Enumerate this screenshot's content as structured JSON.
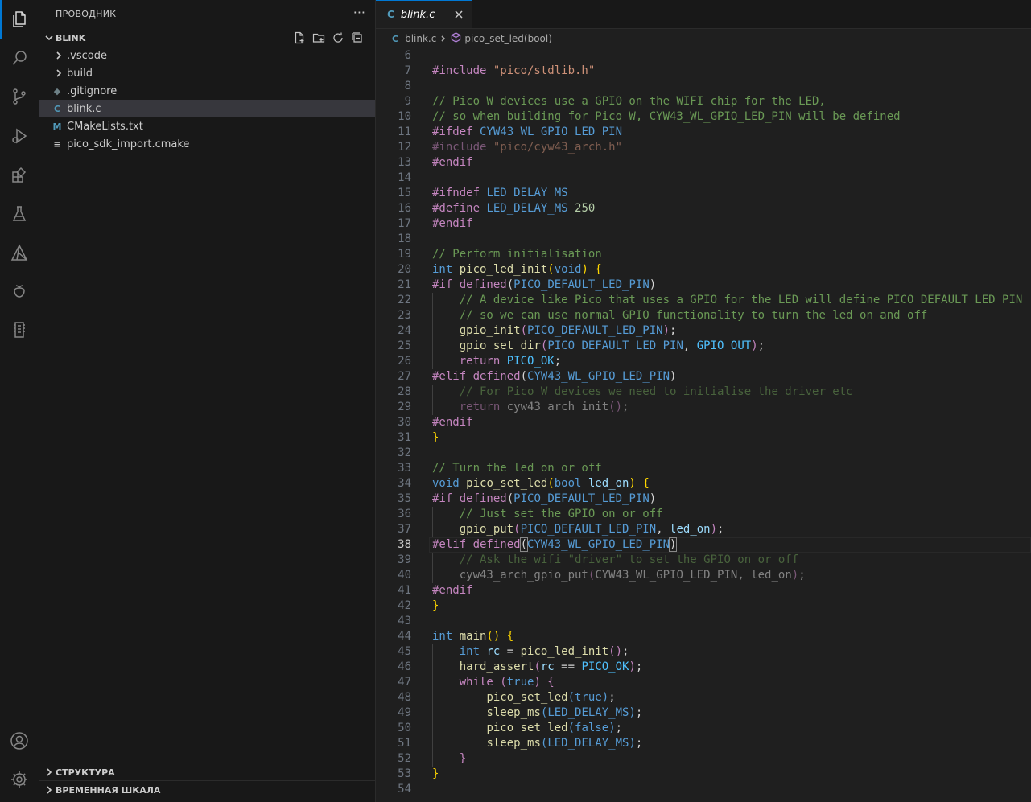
{
  "activity_bar": {
    "items": [
      "explorer-icon",
      "search-icon",
      "source-control-icon",
      "run-debug-icon",
      "extensions-icon",
      "testing-icon",
      "cmake-icon",
      "raspberry-pi-icon",
      "serial-monitor-icon"
    ],
    "bottom": [
      "accounts-icon",
      "settings-gear-icon"
    ]
  },
  "sidebar": {
    "title": "ПРОВОДНИК",
    "folder": "BLINK",
    "items": [
      {
        "label": ".vscode",
        "type": "folder"
      },
      {
        "label": "build",
        "type": "folder"
      },
      {
        "label": ".gitignore",
        "type": "file",
        "icon": "◆",
        "color": "#6d8086"
      },
      {
        "label": "blink.c",
        "type": "file",
        "icon": "C",
        "color": "#519aba",
        "selected": true
      },
      {
        "label": "CMakeLists.txt",
        "type": "file",
        "icon": "M",
        "color": "#519aba"
      },
      {
        "label": "pico_sdk_import.cmake",
        "type": "file",
        "icon": "≡",
        "color": "#cccccc"
      }
    ],
    "bottom_sections": [
      "СТРУКТУРА",
      "ВРЕМЕННАЯ ШКАЛА"
    ]
  },
  "editor": {
    "tab": {
      "icon": "C",
      "label": "blink.c"
    },
    "breadcrumb": {
      "file_icon": "C",
      "file": "blink.c",
      "symbol": "pico_set_led(bool)"
    },
    "current_line": 38,
    "lines": [
      {
        "n": 6,
        "indent": 0,
        "tokens": []
      },
      {
        "n": 7,
        "indent": 0,
        "tokens": [
          [
            "p",
            "#include "
          ],
          [
            "s",
            "\"pico/stdlib.h\""
          ]
        ]
      },
      {
        "n": 8,
        "indent": 0,
        "tokens": []
      },
      {
        "n": 9,
        "indent": 0,
        "tokens": [
          [
            "c",
            "// Pico W devices use a GPIO on the WIFI chip for the LED,"
          ]
        ]
      },
      {
        "n": 10,
        "indent": 0,
        "tokens": [
          [
            "c",
            "// so when building for Pico W, CYW43_WL_GPIO_LED_PIN will be defined"
          ]
        ]
      },
      {
        "n": 11,
        "indent": 0,
        "tokens": [
          [
            "p",
            "#ifdef "
          ],
          [
            "m",
            "CYW43_WL_GPIO_LED_PIN"
          ]
        ]
      },
      {
        "n": 12,
        "indent": 0,
        "dim": true,
        "tokens": [
          [
            "p",
            "#include "
          ],
          [
            "s",
            "\"pico/cyw43_arch.h\""
          ]
        ]
      },
      {
        "n": 13,
        "indent": 0,
        "tokens": [
          [
            "p",
            "#endif"
          ]
        ]
      },
      {
        "n": 14,
        "indent": 0,
        "tokens": []
      },
      {
        "n": 15,
        "indent": 0,
        "tokens": [
          [
            "p",
            "#ifndef "
          ],
          [
            "m",
            "LED_DELAY_MS"
          ]
        ]
      },
      {
        "n": 16,
        "indent": 0,
        "tokens": [
          [
            "p",
            "#define "
          ],
          [
            "m",
            "LED_DELAY_MS "
          ],
          [
            "n",
            "250"
          ]
        ]
      },
      {
        "n": 17,
        "indent": 0,
        "tokens": [
          [
            "p",
            "#endif"
          ]
        ]
      },
      {
        "n": 18,
        "indent": 0,
        "tokens": []
      },
      {
        "n": 19,
        "indent": 0,
        "tokens": [
          [
            "c",
            "// Perform initialisation"
          ]
        ]
      },
      {
        "n": 20,
        "indent": 0,
        "tokens": [
          [
            "k",
            "int "
          ],
          [
            "f",
            "pico_led_init"
          ],
          [
            "y",
            "("
          ],
          [
            "k",
            "void"
          ],
          [
            "y",
            ") {"
          ]
        ]
      },
      {
        "n": 21,
        "indent": 0,
        "tokens": [
          [
            "p",
            "#if "
          ],
          [
            "p",
            "defined"
          ],
          [
            "t",
            "("
          ],
          [
            "m",
            "PICO_DEFAULT_LED_PIN"
          ],
          [
            "t",
            ")"
          ]
        ]
      },
      {
        "n": 22,
        "indent": 1,
        "tokens": [
          [
            "c",
            "// A device like Pico that uses a GPIO for the LED will define PICO_DEFAULT_LED_PIN"
          ]
        ]
      },
      {
        "n": 23,
        "indent": 1,
        "tokens": [
          [
            "c",
            "// so we can use normal GPIO functionality to turn the led on and off"
          ]
        ]
      },
      {
        "n": 24,
        "indent": 1,
        "tokens": [
          [
            "f",
            "gpio_init"
          ],
          [
            "p",
            "("
          ],
          [
            "m",
            "PICO_DEFAULT_LED_PIN"
          ],
          [
            "p",
            ")"
          ],
          [
            "t",
            ";"
          ]
        ]
      },
      {
        "n": 25,
        "indent": 1,
        "tokens": [
          [
            "f",
            "gpio_set_dir"
          ],
          [
            "p",
            "("
          ],
          [
            "m",
            "PICO_DEFAULT_LED_PIN"
          ],
          [
            "t",
            ", "
          ],
          [
            "mc",
            "GPIO_OUT"
          ],
          [
            "p",
            ")"
          ],
          [
            "t",
            ";"
          ]
        ]
      },
      {
        "n": 26,
        "indent": 1,
        "tokens": [
          [
            "p",
            "return "
          ],
          [
            "mc",
            "PICO_OK"
          ],
          [
            "t",
            ";"
          ]
        ]
      },
      {
        "n": 27,
        "indent": 0,
        "tokens": [
          [
            "p",
            "#elif "
          ],
          [
            "p",
            "defined"
          ],
          [
            "t",
            "("
          ],
          [
            "m",
            "CYW43_WL_GPIO_LED_PIN"
          ],
          [
            "t",
            ")"
          ]
        ]
      },
      {
        "n": 28,
        "indent": 1,
        "dim": true,
        "tokens": [
          [
            "c",
            "// For Pico W devices we need to initialise the driver etc"
          ]
        ]
      },
      {
        "n": 29,
        "indent": 1,
        "dim": true,
        "tokens": [
          [
            "p",
            "return "
          ],
          [
            "t",
            "cyw43_arch_init"
          ],
          [
            "p",
            "()"
          ],
          [
            "t",
            ";"
          ]
        ]
      },
      {
        "n": 30,
        "indent": 0,
        "tokens": [
          [
            "p",
            "#endif"
          ]
        ]
      },
      {
        "n": 31,
        "indent": 0,
        "tokens": [
          [
            "y",
            "}"
          ]
        ]
      },
      {
        "n": 32,
        "indent": 0,
        "tokens": []
      },
      {
        "n": 33,
        "indent": 0,
        "tokens": [
          [
            "c",
            "// Turn the led on or off"
          ]
        ]
      },
      {
        "n": 34,
        "indent": 0,
        "tokens": [
          [
            "k",
            "void "
          ],
          [
            "f",
            "pico_set_led"
          ],
          [
            "y",
            "("
          ],
          [
            "k",
            "bool "
          ],
          [
            "v",
            "led_on"
          ],
          [
            "y",
            ") {"
          ]
        ]
      },
      {
        "n": 35,
        "indent": 0,
        "tokens": [
          [
            "p",
            "#if "
          ],
          [
            "p",
            "defined"
          ],
          [
            "t",
            "("
          ],
          [
            "m",
            "PICO_DEFAULT_LED_PIN"
          ],
          [
            "t",
            ")"
          ]
        ]
      },
      {
        "n": 36,
        "indent": 1,
        "tokens": [
          [
            "c",
            "// Just set the GPIO on or off"
          ]
        ]
      },
      {
        "n": 37,
        "indent": 1,
        "tokens": [
          [
            "f",
            "gpio_put"
          ],
          [
            "p",
            "("
          ],
          [
            "m",
            "PICO_DEFAULT_LED_PIN"
          ],
          [
            "t",
            ", "
          ],
          [
            "v",
            "led_on"
          ],
          [
            "p",
            ")"
          ],
          [
            "t",
            ";"
          ]
        ]
      },
      {
        "n": 38,
        "indent": 0,
        "tokens": [
          [
            "p",
            "#elif "
          ],
          [
            "p",
            "defined"
          ],
          [
            "b",
            "("
          ],
          [
            "m",
            "CYW43_WL_GPIO_LED_PIN"
          ],
          [
            "b",
            ")"
          ]
        ]
      },
      {
        "n": 39,
        "indent": 1,
        "dim": true,
        "tokens": [
          [
            "c",
            "// Ask the wifi \"driver\" to set the GPIO on or off"
          ]
        ]
      },
      {
        "n": 40,
        "indent": 1,
        "dim": true,
        "tokens": [
          [
            "t",
            "cyw43_arch_gpio_put"
          ],
          [
            "p",
            "("
          ],
          [
            "t",
            "CYW43_WL_GPIO_LED_PIN, led_on"
          ],
          [
            "p",
            ")"
          ],
          [
            "t",
            ";"
          ]
        ]
      },
      {
        "n": 41,
        "indent": 0,
        "tokens": [
          [
            "p",
            "#endif"
          ]
        ]
      },
      {
        "n": 42,
        "indent": 0,
        "tokens": [
          [
            "y",
            "}"
          ]
        ]
      },
      {
        "n": 43,
        "indent": 0,
        "tokens": []
      },
      {
        "n": 44,
        "indent": 0,
        "tokens": [
          [
            "k",
            "int "
          ],
          [
            "f",
            "main"
          ],
          [
            "y",
            "() {"
          ]
        ]
      },
      {
        "n": 45,
        "indent": 1,
        "tokens": [
          [
            "k",
            "int "
          ],
          [
            "v",
            "rc "
          ],
          [
            "t",
            "= "
          ],
          [
            "f",
            "pico_led_init"
          ],
          [
            "p",
            "()"
          ],
          [
            "t",
            ";"
          ]
        ]
      },
      {
        "n": 46,
        "indent": 1,
        "tokens": [
          [
            "f",
            "hard_assert"
          ],
          [
            "p",
            "("
          ],
          [
            "v",
            "rc "
          ],
          [
            "t",
            "== "
          ],
          [
            "mc",
            "PICO_OK"
          ],
          [
            "p",
            ")"
          ],
          [
            "t",
            ";"
          ]
        ]
      },
      {
        "n": 47,
        "indent": 1,
        "tokens": [
          [
            "p",
            "while "
          ],
          [
            "p",
            "("
          ],
          [
            "k",
            "true"
          ],
          [
            "p",
            ") {"
          ]
        ]
      },
      {
        "n": 48,
        "indent": 2,
        "tokens": [
          [
            "f",
            "pico_set_led"
          ],
          [
            "k",
            "("
          ],
          [
            "k",
            "true"
          ],
          [
            "k",
            ")"
          ],
          [
            "t",
            ";"
          ]
        ]
      },
      {
        "n": 49,
        "indent": 2,
        "tokens": [
          [
            "f",
            "sleep_ms"
          ],
          [
            "k",
            "("
          ],
          [
            "m",
            "LED_DELAY_MS"
          ],
          [
            "k",
            ")"
          ],
          [
            "t",
            ";"
          ]
        ]
      },
      {
        "n": 50,
        "indent": 2,
        "tokens": [
          [
            "f",
            "pico_set_led"
          ],
          [
            "k",
            "("
          ],
          [
            "k",
            "false"
          ],
          [
            "k",
            ")"
          ],
          [
            "t",
            ";"
          ]
        ]
      },
      {
        "n": 51,
        "indent": 2,
        "tokens": [
          [
            "f",
            "sleep_ms"
          ],
          [
            "k",
            "("
          ],
          [
            "m",
            "LED_DELAY_MS"
          ],
          [
            "k",
            ")"
          ],
          [
            "t",
            ";"
          ]
        ]
      },
      {
        "n": 52,
        "indent": 1,
        "tokens": [
          [
            "p",
            "}"
          ]
        ]
      },
      {
        "n": 53,
        "indent": 0,
        "tokens": [
          [
            "y",
            "}"
          ]
        ]
      },
      {
        "n": 54,
        "indent": 0,
        "tokens": []
      }
    ]
  }
}
